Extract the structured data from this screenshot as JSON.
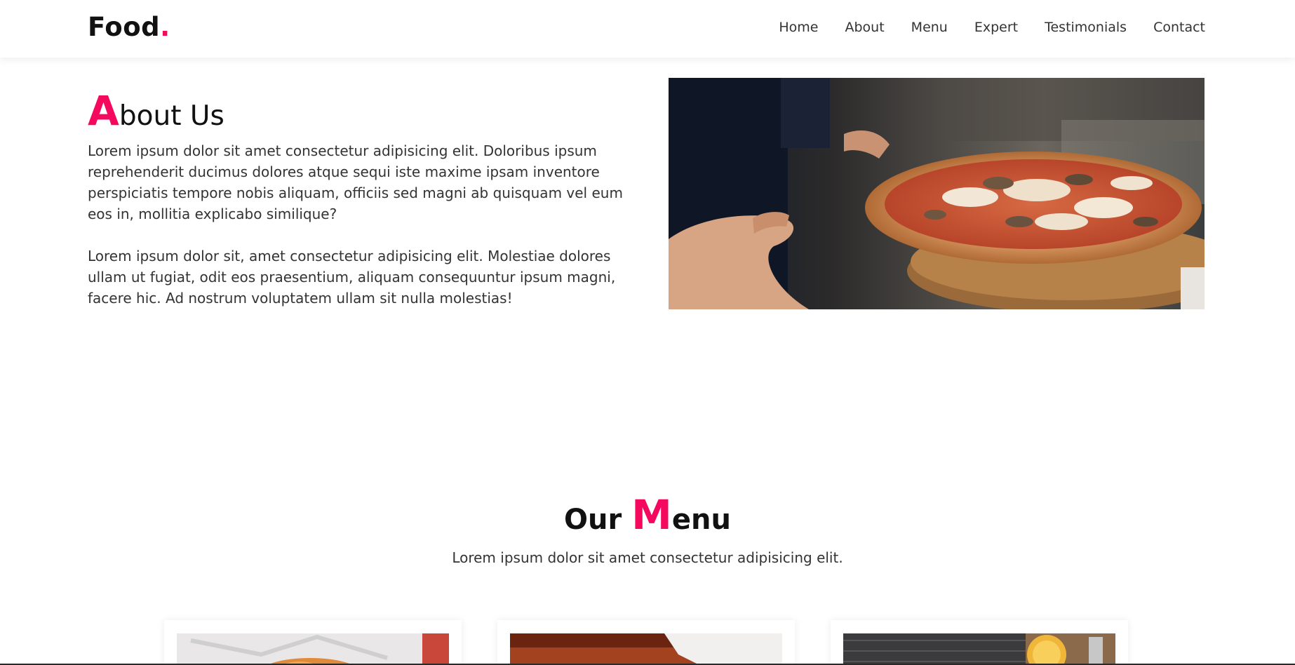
{
  "nav": {
    "brand": "Food",
    "brand_dot": ".",
    "links": [
      "Home",
      "About",
      "Menu",
      "Expert",
      "Testimonials",
      "Contact"
    ]
  },
  "about": {
    "title_cap": "A",
    "title_rest": "bout Us",
    "paragraphs": [
      "Lorem ipsum dolor sit amet consectetur adipisicing elit. Doloribus ipsum reprehenderit ducimus dolores atque sequi iste maxime ipsam inventore perspiciatis tempore nobis aliquam, officiis sed magni ab quisquam vel eum eos in, mollitia explicabo similique?",
      "Lorem ipsum dolor sit, amet consectetur adipisicing elit. Molestiae dolores ullam ut fugiat, odit eos praesentium, aliquam consequuntur ipsum magni, facere hic. Ad nostrum voluptatem ullam sit nulla molestias!"
    ]
  },
  "menu": {
    "title_pre": "Our ",
    "title_cap": "M",
    "title_rest": "enu",
    "subtitle": "Lorem ipsum dolor sit amet consectetur adipisicing elit."
  },
  "colors": {
    "accent": "#f4095f",
    "text": "#333333",
    "heading": "#111111"
  }
}
